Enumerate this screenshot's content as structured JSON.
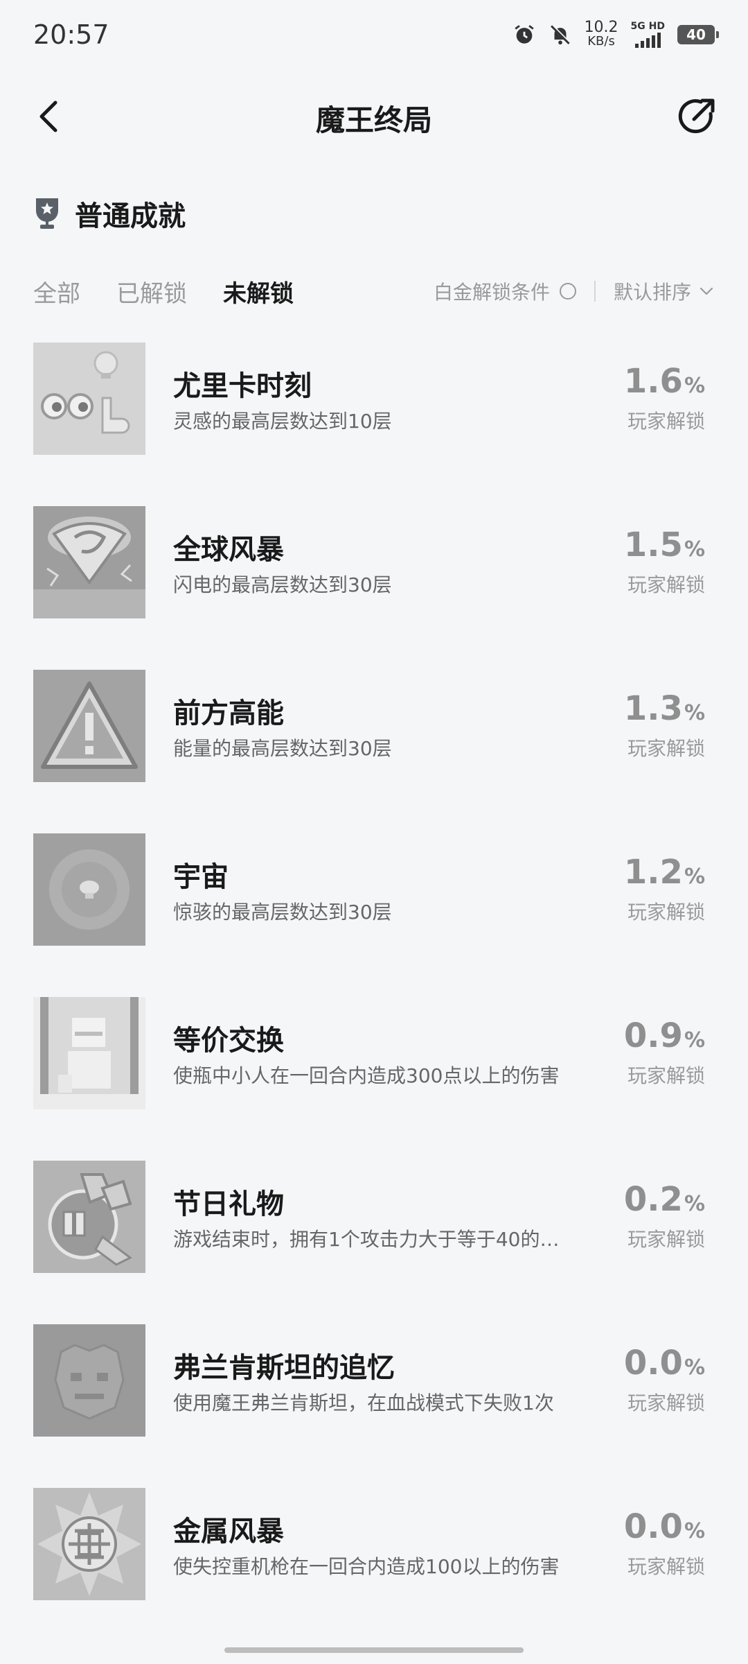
{
  "status": {
    "time": "20:57",
    "net_speed_value": "10.2",
    "net_speed_unit": "KB/s",
    "signal_label": "5G HD",
    "battery": "40"
  },
  "header": {
    "title": "魔王终局"
  },
  "section": {
    "title": "普通成就"
  },
  "tabs": [
    {
      "label": "全部",
      "active": false
    },
    {
      "label": "已解锁",
      "active": false
    },
    {
      "label": "未解锁",
      "active": true
    }
  ],
  "filters": {
    "platinum_label": "白金解锁条件",
    "sort_label": "默认排序"
  },
  "achievements": [
    {
      "title": "尤里卡时刻",
      "desc": "灵感的最高层数达到10层",
      "percent": "1.6",
      "unit": "%",
      "percent_label": "玩家解锁",
      "icon": "eyes-lightbulb-icon"
    },
    {
      "title": "全球风暴",
      "desc": "闪电的最高层数达到30层",
      "percent": "1.5",
      "unit": "%",
      "percent_label": "玩家解锁",
      "icon": "storm-icon"
    },
    {
      "title": "前方高能",
      "desc": "能量的最高层数达到30层",
      "percent": "1.3",
      "unit": "%",
      "percent_label": "玩家解锁",
      "icon": "warning-sign-icon"
    },
    {
      "title": "宇宙",
      "desc": "惊骇的最高层数达到30层",
      "percent": "1.2",
      "unit": "%",
      "percent_label": "玩家解锁",
      "icon": "cosmos-icon"
    },
    {
      "title": "等价交换",
      "desc": "使瓶中小人在一回合内造成300点以上的伤害",
      "percent": "0.9",
      "unit": "%",
      "percent_label": "玩家解锁",
      "icon": "bottle-figure-icon"
    },
    {
      "title": "节日礼物",
      "desc": "游戏结束时，拥有1个攻击力大于等于40的…",
      "percent": "0.2",
      "unit": "%",
      "percent_label": "玩家解锁",
      "icon": "gift-icon"
    },
    {
      "title": "弗兰肯斯坦的追忆",
      "desc": "使用魔王弗兰肯斯坦，在血战模式下失败1次",
      "percent": "0.0",
      "unit": "%",
      "percent_label": "玩家解锁",
      "icon": "monster-face-icon"
    },
    {
      "title": "金属风暴",
      "desc": "使失控重机枪在一回合内造成100以上的伤害",
      "percent": "0.0",
      "unit": "%",
      "percent_label": "玩家解锁",
      "icon": "metal-wheel-icon"
    }
  ]
}
